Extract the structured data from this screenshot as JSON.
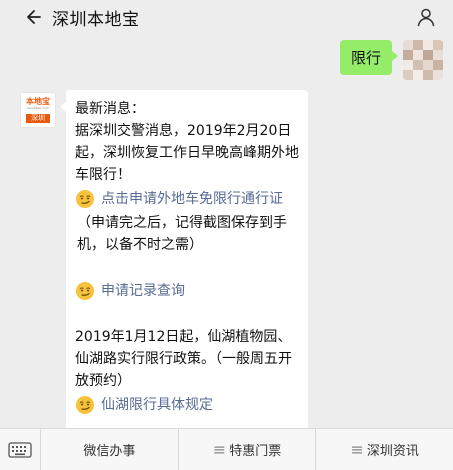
{
  "header": {
    "title": "深圳本地宝"
  },
  "outgoing": {
    "text": "限行"
  },
  "bot": {
    "logo_top": "本地宝",
    "logo_mid": "bendibao.com",
    "logo_city": "深圳"
  },
  "message": {
    "heading": "最新消息：",
    "para1": "据深圳交警消息，2019年2月20日起，深圳恢复工作日早晚高峰期外地车限行！",
    "link1": "点击申请外地车免限行通行证",
    "note1": "（申请完之后，记得截图保存到手机，以备不时之需）",
    "link2": "申请记录查询",
    "para2": "2019年1月12日起，仙湖植物园、仙湖路实行限行政策。（一般周五开放预约）",
    "link3": "仙湖限行具体规定"
  },
  "menu": {
    "items": [
      {
        "label": "微信办事"
      },
      {
        "label": "特惠门票"
      },
      {
        "label": "深圳资讯"
      }
    ]
  },
  "colors": {
    "outgoing_bubble": "#95ec69",
    "link": "#576b95",
    "brand": "#e8590c",
    "background": "#ededed"
  }
}
